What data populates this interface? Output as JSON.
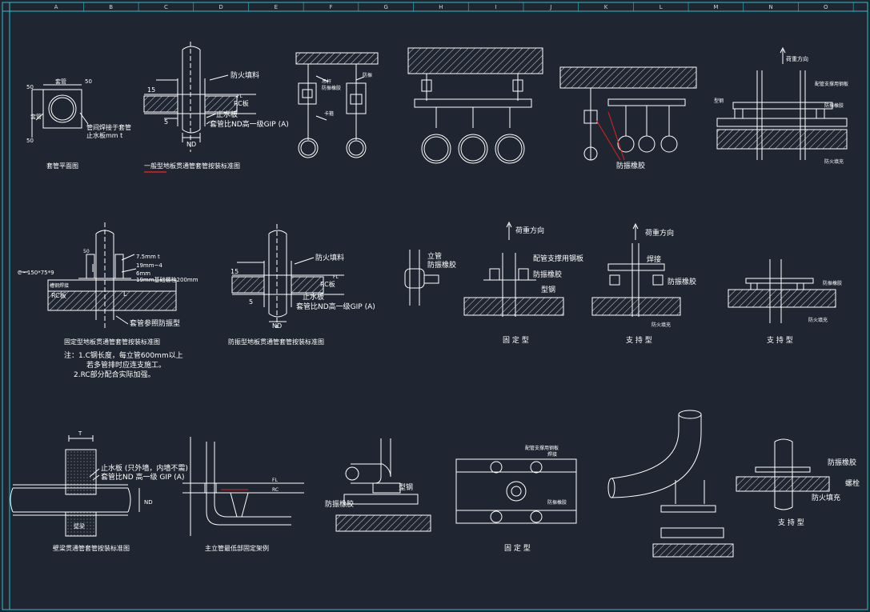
{
  "colors": {
    "background": "#1f2631",
    "frame": "#27c2c8",
    "line": "#ffffff",
    "highlight_red": "#e0201c"
  },
  "ruler": {
    "letters": [
      "A",
      "B",
      "C",
      "D",
      "E",
      "F",
      "G",
      "H",
      "I",
      "J",
      "K",
      "L",
      "M",
      "N",
      "O"
    ]
  },
  "drawings": {
    "sleeve_plan": {
      "title": "套管平面图",
      "dim_top_left": "50",
      "dim_top_right": "50",
      "dim_bottom": "50",
      "label_sleeve_top": "套管",
      "label_sleeve_left": "套管",
      "note_gap": "管间焊接于套管",
      "note_plate": "止水板mm t"
    },
    "general_floor": {
      "title": "一般型地板贯通管套管按装标准图",
      "fire_fill": "防火填料",
      "fl": "FL",
      "rc_floor": "RC板",
      "water_stop": "止水板",
      "sleeve_note": "套管比ND高一级GIP (A)",
      "dim_15": "15",
      "dim_5": "5",
      "nd": "ND"
    },
    "hanger_1": {
      "label_a": "吊杆",
      "label_b": "防振橡胶",
      "label_c": "卡箍",
      "label_d": "防振"
    },
    "hanger_3": {
      "label": "防振橡胶"
    },
    "support_top": {
      "load_dir": "荷重方向",
      "label_plate": "配管支撑用钢板",
      "label_rubber": "防振橡胶",
      "label_steel": "型钢",
      "label_fire": "防火填充"
    },
    "fixed_floor": {
      "title": "固定型地板贯通管套管按装标准图",
      "c_steel": "C - 150*75*9",
      "dim_50": "50",
      "t75": "7.5mm t",
      "t19": "19mm~4",
      "t6": "6mm",
      "dim_a": "19mm基础螺栓200mm",
      "steel_label": "槽钢焊接",
      "rc_floor": "RC板",
      "sleeve_ref": "套管参照防振型",
      "note_1": "注：1.C钢长度，每立管600mm以上",
      "note_1b": "若多管排时应连支施工。",
      "note_2": "2.RC部分配合实际加强。",
      "dim_l": "L"
    },
    "antivib_floor": {
      "title": "防振型地板贯通管套管按装标准图",
      "fire_fill": "防火填料",
      "fl": "FL",
      "rc_floor": "RC板",
      "water_stop": "止水板",
      "sleeve_note": "套管比ND高一级GIP (A)",
      "dim_15": "15",
      "dim_5": "5",
      "nd": "ND"
    },
    "riser_clamp": {
      "label_riser": "立管",
      "label_rubber": "防振橡胶"
    },
    "fixed_type_1": {
      "title": "固  定  型",
      "load_dir": "荷重方向",
      "plate": "配管支撑用钢板",
      "rubber": "防振橡胶",
      "steel": "型钢"
    },
    "support_type_1": {
      "title": "支  持  型",
      "load_dir": "荷重方向",
      "weld": "焊接",
      "rubber": "防振橡胶",
      "fire": "防火填充"
    },
    "support_type_2": {
      "title": "支  持  型",
      "rubber": "防振橡胶",
      "fire": "防火填充"
    },
    "beam_sleeve": {
      "title": "壁梁贯通管套管按装标准图",
      "t_label": "T",
      "water_stop": "止水板 (只外墙，内墙不需)",
      "sleeve_note": "套管比ND 高一级 GIP (A)",
      "nd": "ND",
      "beam": "壁梁"
    },
    "riser_bottom": {
      "title": "主立管最低部固定架例",
      "fl": "FL",
      "rc": "RC"
    },
    "base_support": {
      "steel": "型钢",
      "rubber": "防振橡胶"
    },
    "fixed_type_2": {
      "title": "固  定  型",
      "plate": "配管支撑用钢板",
      "weld": "焊接",
      "rubber": "防振橡胶"
    },
    "support_type_3": {
      "title": "支  持  型",
      "rubber": "防振橡胶",
      "bolt": "螺栓",
      "fire": "防火填充"
    }
  }
}
